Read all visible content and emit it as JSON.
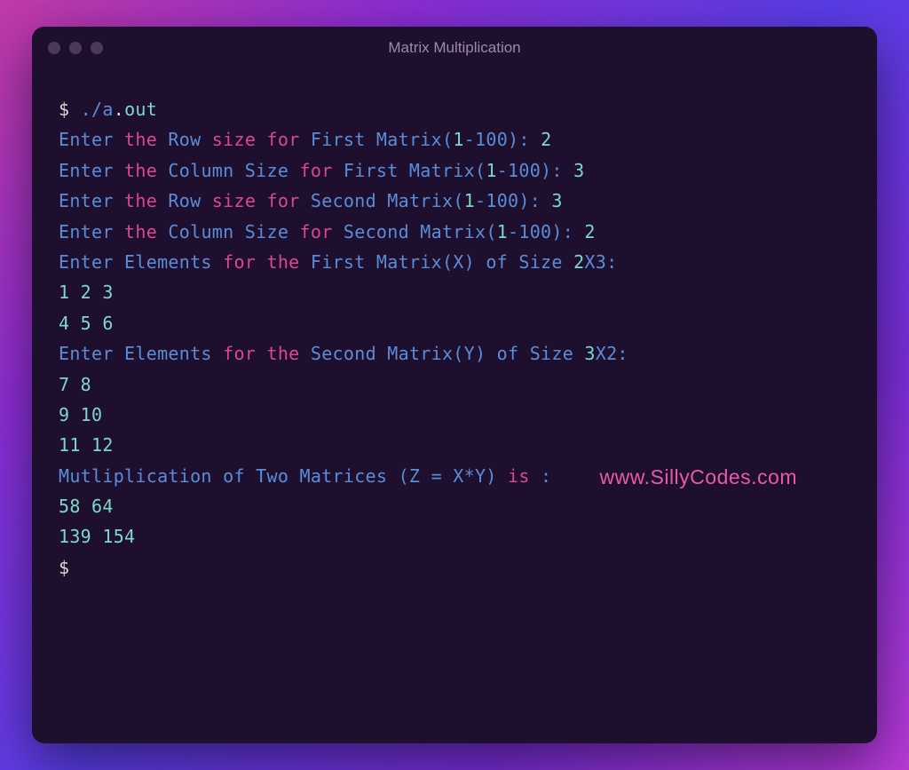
{
  "window": {
    "title": "Matrix Multiplication"
  },
  "watermark": "www.SillyCodes.com",
  "terminal": {
    "prompt": "$",
    "command_prefix": "./a",
    "command_dot": ".",
    "command_ext": "out",
    "lines": {
      "l1_p1": "Enter ",
      "l1_p2": "the",
      "l1_p3": " Row ",
      "l1_p4": "size",
      "l1_p5": " ",
      "l1_p6": "for",
      "l1_p7": " First Matrix(",
      "l1_p8": "1",
      "l1_p9": "-100): ",
      "l1_p10": "2",
      "l2_p1": "Enter ",
      "l2_p2": "the",
      "l2_p3": " Column Size ",
      "l2_p4": "for",
      "l2_p5": " First Matrix(",
      "l2_p6": "1",
      "l2_p7": "-100): ",
      "l2_p8": "3",
      "l3_p1": "Enter ",
      "l3_p2": "the",
      "l3_p3": " Row ",
      "l3_p4": "size",
      "l3_p5": " ",
      "l3_p6": "for",
      "l3_p7": " Second Matrix(",
      "l3_p8": "1",
      "l3_p9": "-100): ",
      "l3_p10": "3",
      "l4_p1": "Enter ",
      "l4_p2": "the",
      "l4_p3": " Column Size ",
      "l4_p4": "for",
      "l4_p5": " Second Matrix(",
      "l4_p6": "1",
      "l4_p7": "-100): ",
      "l4_p8": "2",
      "l5_p1": "Enter Elements ",
      "l5_p2": "for",
      "l5_p3": " ",
      "l5_p4": "the",
      "l5_p5": " First Matrix(X) of Size ",
      "l5_p6": "2",
      "l5_p7": "X3:",
      "l6": "1 2 3",
      "l7": "4 5 6",
      "l8_p1": "Enter Elements ",
      "l8_p2": "for",
      "l8_p3": " ",
      "l8_p4": "the",
      "l8_p5": " Second Matrix(Y) of Size ",
      "l8_p6": "3",
      "l8_p7": "X2:",
      "l9": "7 8",
      "l10": "9 10",
      "l11": "11 12",
      "l12_p1": "Mutliplication of Two Matrices (Z = X*Y) ",
      "l12_p2": "is",
      "l12_p3": " :",
      "l13": "58 64",
      "l14": "139 154",
      "l15": "$"
    }
  }
}
